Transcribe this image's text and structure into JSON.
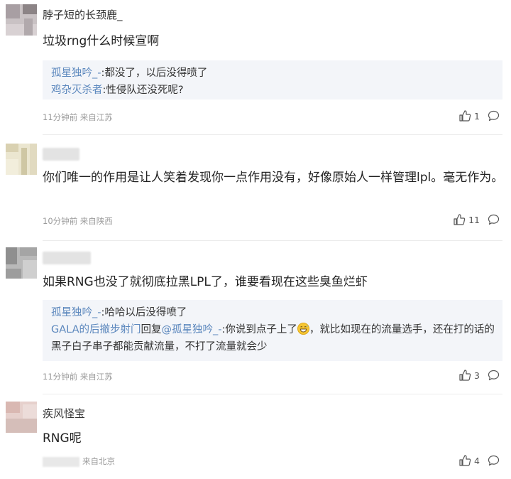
{
  "comments": [
    {
      "username": "脖子短的长颈鹿_",
      "text": "垃圾rng什么时候宣啊",
      "replies": [
        {
          "name": "孤星独吟_-",
          "text": ":都没了，以后没得喷了"
        },
        {
          "name": "鸡杂灭杀者",
          "text": ":性侵队还没死呢?"
        }
      ],
      "meta": "11分钟前 来自江苏",
      "likes": "1"
    },
    {
      "username": "",
      "text": "你们唯一的作用是让人笑着发现你一点作用没有，好像原始人一样管理lpl。毫无作为。",
      "meta": "10分钟前 来自陕西",
      "likes": "11"
    },
    {
      "username": "",
      "text": "如果RNG也没了就彻底拉黑LPL了，谁要看现在这些臭鱼烂虾",
      "replies": [
        {
          "name": "孤星独吟_-",
          "text": ":哈哈以后没得喷了"
        },
        {
          "name": "GALA的后撤步射门",
          "mid": "回复",
          "name2": "@孤星独吟_-",
          "text": ":你说到点子上了",
          "text2": "，就比如现在的流量选手，还在打的话的黑子白子串子都能贡献流量，不打了流量就会少"
        }
      ],
      "meta": "11分钟前 来自江苏",
      "likes": "3"
    },
    {
      "username": "疾风怪宝",
      "text": "RNG呢",
      "meta": "来自北京",
      "likes": "4"
    }
  ],
  "icons": {
    "like": "thumbs-up-icon",
    "comment": "speech-bubble-icon",
    "emoji": "grin-sweat-emoji"
  },
  "colors": {
    "reply_name": "#5b87bd",
    "reply_bg": "#f3f5f9",
    "meta": "#9a9a9a"
  }
}
